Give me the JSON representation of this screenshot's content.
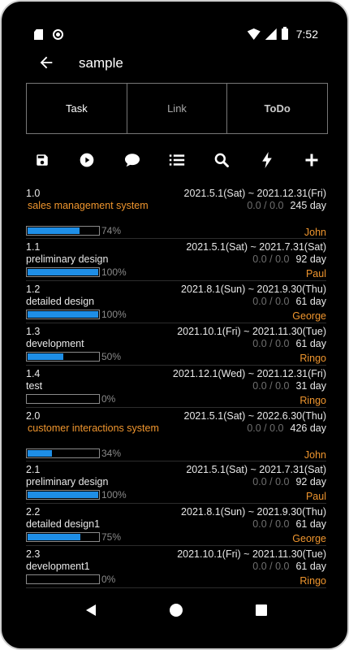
{
  "status": {
    "time": "7:52"
  },
  "app": {
    "title": "sample"
  },
  "tabs": [
    {
      "label": "Task"
    },
    {
      "label": "Link"
    },
    {
      "label": "ToDo"
    }
  ],
  "toolbar": [
    "save-icon",
    "play-icon",
    "comment-icon",
    "list-icon",
    "search-icon",
    "flash-icon",
    "add-icon"
  ],
  "tasks": [
    {
      "num": "1.0",
      "dates": "2021.5.1(Sat) ~ 2021.12.31(Fri)",
      "name": "sales management system",
      "orange": true,
      "ratio": "0.0 / 0.0",
      "days": "245 day",
      "progress": 74,
      "pct": "74%",
      "owner": "John"
    },
    {
      "num": "1.1",
      "dates": "2021.5.1(Sat) ~ 2021.7.31(Sat)",
      "name": "preliminary design",
      "orange": false,
      "ratio": "0.0 / 0.0",
      "days": "92 day",
      "progress": 100,
      "pct": "100%",
      "owner": "Paul"
    },
    {
      "num": "1.2",
      "dates": "2021.8.1(Sun) ~ 2021.9.30(Thu)",
      "name": "detailed design",
      "orange": false,
      "ratio": "0.0 / 0.0",
      "days": "61 day",
      "progress": 100,
      "pct": "100%",
      "owner": "George"
    },
    {
      "num": "1.3",
      "dates": "2021.10.1(Fri) ~ 2021.11.30(Tue)",
      "name": "development",
      "orange": false,
      "ratio": "0.0 / 0.0",
      "days": "61 day",
      "progress": 50,
      "pct": "50%",
      "owner": "Ringo"
    },
    {
      "num": "1.4",
      "dates": "2021.12.1(Wed) ~ 2021.12.31(Fri)",
      "name": "test",
      "orange": false,
      "ratio": "0.0 / 0.0",
      "days": "31 day",
      "progress": 0,
      "pct": "0%",
      "owner": "Ringo"
    },
    {
      "num": "2.0",
      "dates": "2021.5.1(Sat) ~ 2022.6.30(Thu)",
      "name": "customer interactions system",
      "orange": true,
      "ratio": "0.0 / 0.0",
      "days": "426 day",
      "progress": 34,
      "pct": "34%",
      "owner": "John"
    },
    {
      "num": "2.1",
      "dates": "2021.5.1(Sat) ~ 2021.7.31(Sat)",
      "name": "preliminary design",
      "orange": false,
      "ratio": "0.0 / 0.0",
      "days": "92 day",
      "progress": 100,
      "pct": "100%",
      "owner": "Paul"
    },
    {
      "num": "2.2",
      "dates": "2021.8.1(Sun) ~ 2021.9.30(Thu)",
      "name": "detailed design1",
      "orange": false,
      "ratio": "0.0 / 0.0",
      "days": "61 day",
      "progress": 75,
      "pct": "75%",
      "owner": "George"
    },
    {
      "num": "2.3",
      "dates": "2021.10.1(Fri) ~ 2021.11.30(Tue)",
      "name": "development1",
      "orange": false,
      "ratio": "0.0 / 0.0",
      "days": "61 day",
      "progress": 0,
      "pct": "0%",
      "owner": "Ringo"
    }
  ],
  "colors": {
    "accent": "#f0962e",
    "progress": "#1e8ee6",
    "background": "#000000"
  }
}
